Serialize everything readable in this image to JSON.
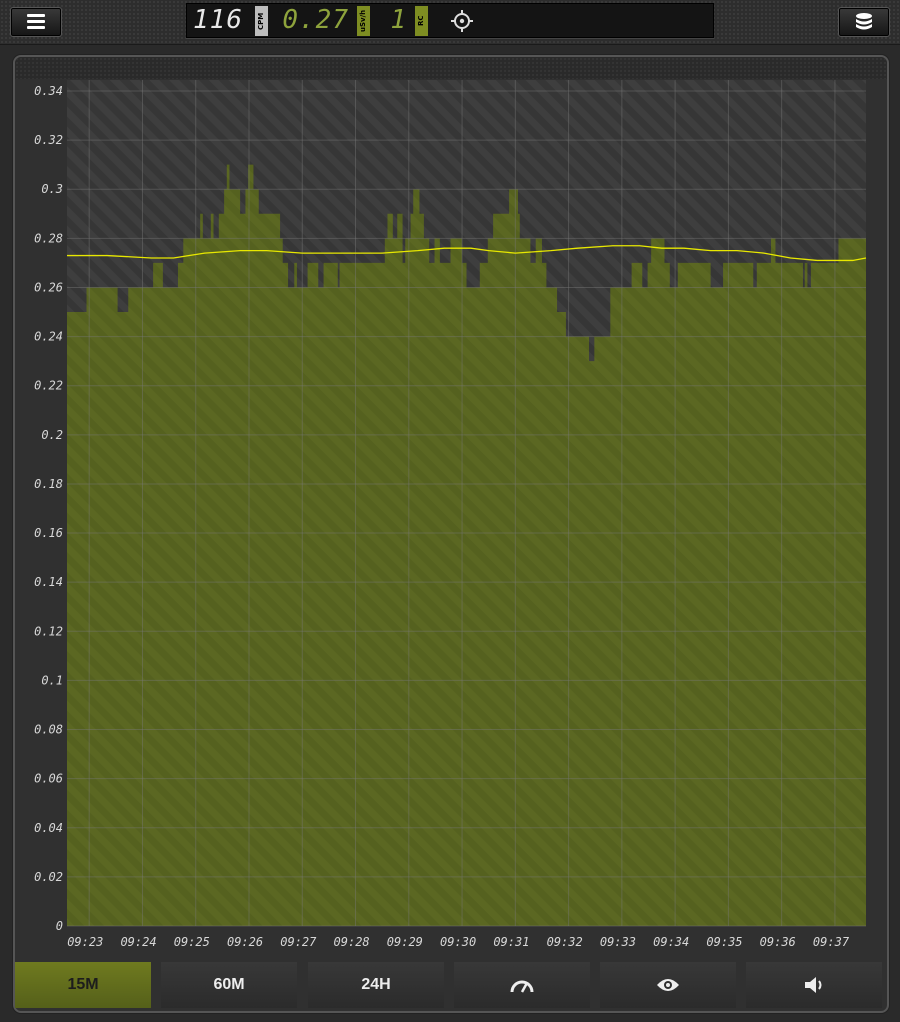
{
  "topbar": {
    "cpm_value": "116",
    "cpm_unit": "CPM",
    "dose_value": "0.27",
    "dose_unit": "uSv/h",
    "rc_value": "1",
    "rc_unit": "RC"
  },
  "colors": {
    "fill": "#5a6622",
    "accent": "#7e8d22",
    "avg_line": "#e8e800",
    "plot_bg": "#3d3d3d"
  },
  "tabs": [
    {
      "label": "15M",
      "active": true
    },
    {
      "label": "60M",
      "active": false
    },
    {
      "label": "24H",
      "active": false
    },
    {
      "icon": "speedometer-icon"
    },
    {
      "icon": "eye-icon"
    },
    {
      "icon": "speaker-icon"
    }
  ],
  "chart_data": {
    "type": "area",
    "title": "",
    "xlabel": "",
    "ylabel": "",
    "ylim": [
      0,
      0.34
    ],
    "xlim": [
      "09:22:35",
      "09:37:35"
    ],
    "grid": true,
    "y_ticks": [
      "0",
      "0.02",
      "0.04",
      "0.06",
      "0.08",
      "0.1",
      "0.12",
      "0.14",
      "0.16",
      "0.18",
      "0.2",
      "0.22",
      "0.24",
      "0.26",
      "0.28",
      "0.3",
      "0.32",
      "0.34"
    ],
    "x_ticks": [
      "09:23",
      "09:24",
      "09:25",
      "09:26",
      "09:27",
      "09:28",
      "09:29",
      "09:30",
      "09:31",
      "09:32",
      "09:33",
      "09:34",
      "09:35",
      "09:36",
      "09:37"
    ],
    "series": [
      {
        "kind": "step-area",
        "x": [
          "09:22:35",
          "09:22:57",
          "09:23:32",
          "09:23:44",
          "09:24:06",
          "09:24:12",
          "09:24:23",
          "09:24:40",
          "09:24:46",
          "09:25:05",
          "09:25:08",
          "09:25:17",
          "09:25:20",
          "09:25:26",
          "09:25:32",
          "09:25:35",
          "09:25:38",
          "09:25:50",
          "09:25:56",
          "09:25:59",
          "09:26:05",
          "09:26:11",
          "09:26:17",
          "09:26:35",
          "09:26:38",
          "09:26:44",
          "09:26:51",
          "09:26:54",
          "09:27:06",
          "09:27:12",
          "09:27:18",
          "09:27:24",
          "09:27:40",
          "09:27:42",
          "09:28:00",
          "09:28:33",
          "09:28:36",
          "09:28:42",
          "09:28:47",
          "09:28:53",
          "09:28:56",
          "09:29:02",
          "09:29:05",
          "09:29:12",
          "09:29:17",
          "09:29:23",
          "09:29:29",
          "09:29:35",
          "09:29:41",
          "09:29:47",
          "09:30:00",
          "09:30:05",
          "09:30:20",
          "09:30:23",
          "09:30:29",
          "09:30:35",
          "09:30:53",
          "09:31:03",
          "09:31:05",
          "09:31:12",
          "09:31:17",
          "09:31:23",
          "09:31:30",
          "09:31:35",
          "09:31:47",
          "09:31:57",
          "09:32:18",
          "09:32:23",
          "09:32:29",
          "09:32:47",
          "09:32:53",
          "09:33:11",
          "09:33:23",
          "09:33:29",
          "09:33:33",
          "09:33:44",
          "09:33:48",
          "09:33:54",
          "09:34:03",
          "09:34:37",
          "09:34:40",
          "09:34:54",
          "09:35:28",
          "09:35:32",
          "09:35:48",
          "09:35:53",
          "09:36:17",
          "09:36:24",
          "09:36:26",
          "09:36:29",
          "09:36:33",
          "09:36:45",
          "09:36:50",
          "09:37:04",
          "09:37:35"
        ],
        "values": [
          0.25,
          0.26,
          0.25,
          0.26,
          0.26,
          0.27,
          0.26,
          0.27,
          0.28,
          0.29,
          0.28,
          0.29,
          0.28,
          0.29,
          0.3,
          0.31,
          0.3,
          0.29,
          0.3,
          0.31,
          0.3,
          0.29,
          0.29,
          0.28,
          0.27,
          0.26,
          0.27,
          0.26,
          0.27,
          0.27,
          0.26,
          0.27,
          0.26,
          0.27,
          0.27,
          0.28,
          0.29,
          0.28,
          0.29,
          0.27,
          0.28,
          0.29,
          0.3,
          0.29,
          0.28,
          0.27,
          0.28,
          0.27,
          0.27,
          0.28,
          0.27,
          0.26,
          0.27,
          0.27,
          0.28,
          0.29,
          0.3,
          0.29,
          0.28,
          0.28,
          0.27,
          0.28,
          0.27,
          0.26,
          0.25,
          0.24,
          0.24,
          0.23,
          0.24,
          0.26,
          0.26,
          0.27,
          0.26,
          0.27,
          0.28,
          0.28,
          0.27,
          0.26,
          0.27,
          0.27,
          0.26,
          0.27,
          0.26,
          0.27,
          0.28,
          0.27,
          0.27,
          0.26,
          0.27,
          0.26,
          0.27,
          0.27,
          0.27,
          0.28,
          0.27
        ],
        "color": "#5a6622"
      },
      {
        "kind": "line",
        "x": [
          "09:22:35",
          "09:23:20",
          "09:24:10",
          "09:24:35",
          "09:25:10",
          "09:25:50",
          "09:26:20",
          "09:27:00",
          "09:27:40",
          "09:28:30",
          "09:29:10",
          "09:29:40",
          "09:30:10",
          "09:30:30",
          "09:31:00",
          "09:31:40",
          "09:32:10",
          "09:32:50",
          "09:33:20",
          "09:33:45",
          "09:34:10",
          "09:34:40",
          "09:35:10",
          "09:35:40",
          "09:36:10",
          "09:36:40",
          "09:37:20",
          "09:37:35"
        ],
        "values": [
          0.273,
          0.273,
          0.272,
          0.272,
          0.274,
          0.275,
          0.275,
          0.274,
          0.274,
          0.274,
          0.275,
          0.276,
          0.276,
          0.275,
          0.274,
          0.275,
          0.276,
          0.277,
          0.277,
          0.276,
          0.276,
          0.275,
          0.275,
          0.274,
          0.272,
          0.271,
          0.271,
          0.272
        ],
        "color": "#e8e800"
      }
    ]
  }
}
